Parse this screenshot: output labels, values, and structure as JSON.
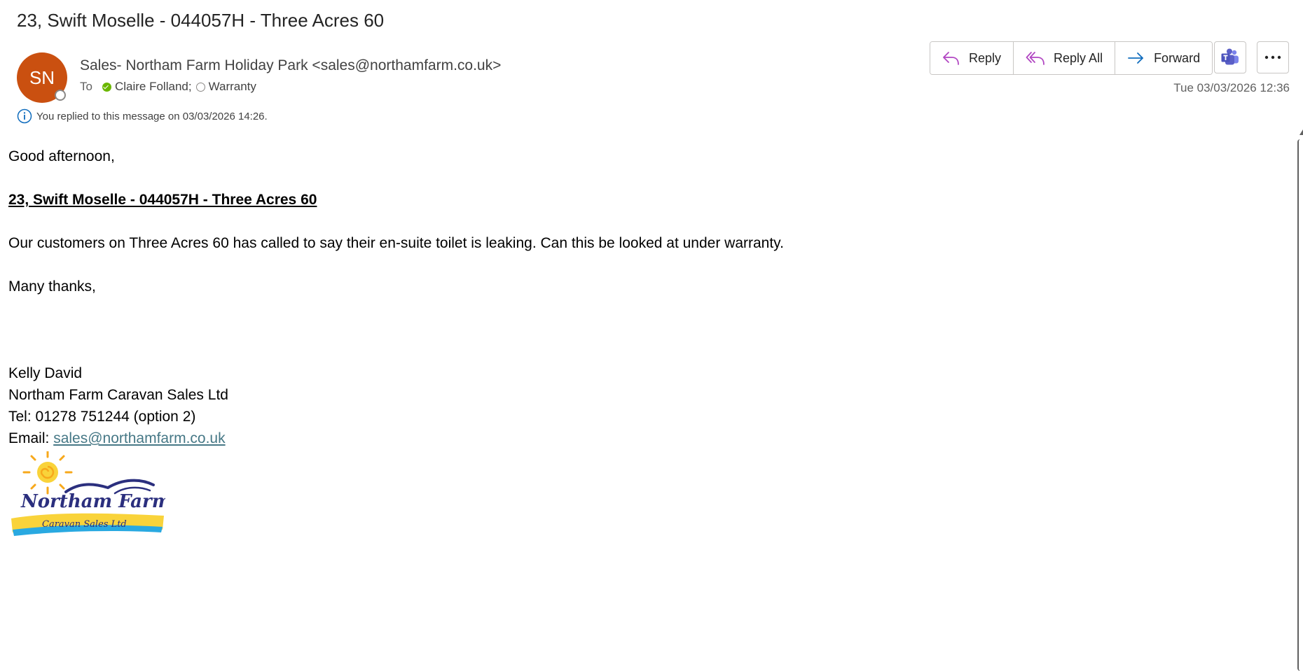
{
  "email": {
    "subject": "23, Swift Moselle - 044057H - Three Acres 60",
    "avatar_initials": "SN",
    "sender": "Sales- Northam Farm Holiday Park <sales@northamfarm.co.uk>",
    "to_label": "To",
    "recipients": [
      {
        "name": "Claire Folland;",
        "status": "available"
      },
      {
        "name": "Warranty",
        "status": "offline"
      }
    ],
    "replied_notice": "You replied to this message on 03/03/2026 14:26.",
    "date": "Tue 03/03/2026 12:36"
  },
  "actions": {
    "reply": "Reply",
    "reply_all": "Reply All",
    "forward": "Forward"
  },
  "body": {
    "greeting": "Good afternoon,",
    "heading": "23, Swift Moselle - 044057H - Three Acres 60",
    "message": "Our customers on Three Acres 60 has called to say their en-suite toilet is leaking.  Can this be looked at under warranty.",
    "signoff": "Many thanks,",
    "sig_name": "Kelly David",
    "sig_company": "Northam Farm Caravan Sales Ltd",
    "sig_tel": "Tel: 01278 751244 (option 2)",
    "sig_email_label": "Email: ",
    "sig_email": "sales@northamfarm.co.uk"
  },
  "logo": {
    "line1": "Northam Farm",
    "line2": "Caravan Sales Ltd"
  },
  "colors": {
    "avatar": "#ca5010",
    "reply_icon": "#b146c2",
    "forward_icon": "#0f6cbd",
    "teams": "#5b5fc7",
    "link": "#467886"
  },
  "icons": {
    "reply": "reply-icon",
    "reply_all": "reply-all-icon",
    "forward": "forward-icon",
    "teams": "teams-icon",
    "more": "more-icon",
    "info": "info-icon"
  }
}
